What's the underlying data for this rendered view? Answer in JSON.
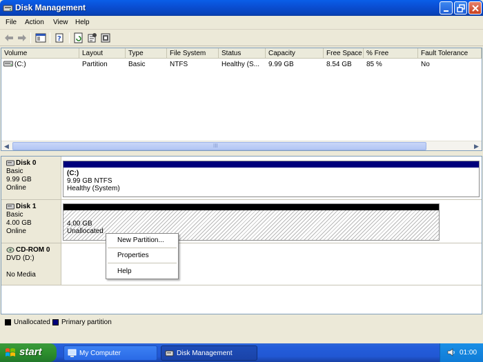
{
  "window": {
    "title": "Disk Management"
  },
  "menu": [
    "File",
    "Action",
    "View",
    "Help"
  ],
  "volume_list": {
    "columns": [
      "Volume",
      "Layout",
      "Type",
      "File System",
      "Status",
      "Capacity",
      "Free Space",
      "% Free",
      "Fault Tolerance"
    ],
    "rows": [
      {
        "volume": "(C:)",
        "layout": "Partition",
        "type": "Basic",
        "file_system": "NTFS",
        "status": "Healthy (S...",
        "capacity": "9.99 GB",
        "free_space": "8.54 GB",
        "pct_free": "85 %",
        "fault_tolerance": "No"
      }
    ],
    "scroll_grip": "III"
  },
  "disks": [
    {
      "name": "Disk 0",
      "type": "Basic",
      "size": "9.99 GB",
      "state": "Online",
      "partition": {
        "label": "(C:)",
        "detail": "9.99 GB NTFS",
        "status": "Healthy (System)"
      }
    },
    {
      "name": "Disk 1",
      "type": "Basic",
      "size": "4.00 GB",
      "state": "Online",
      "partition": {
        "detail": "4.00 GB",
        "status": "Unallocated"
      }
    },
    {
      "name": "CD-ROM 0",
      "type": "DVD (D:)",
      "state": "No Media"
    }
  ],
  "legend": [
    {
      "label": "Unallocated",
      "color": "#000000"
    },
    {
      "label": "Primary partition",
      "color": "#00007c"
    }
  ],
  "context_menu": [
    "New Partition...",
    "Properties",
    "Help"
  ],
  "taskbar": {
    "start_label": "start",
    "tasks": [
      "My Computer",
      "Disk Management"
    ],
    "clock": "01:00"
  },
  "colors": {
    "primary_partition": "#00007c",
    "unallocated": "#000000",
    "title_bar": "#0a50d4"
  }
}
